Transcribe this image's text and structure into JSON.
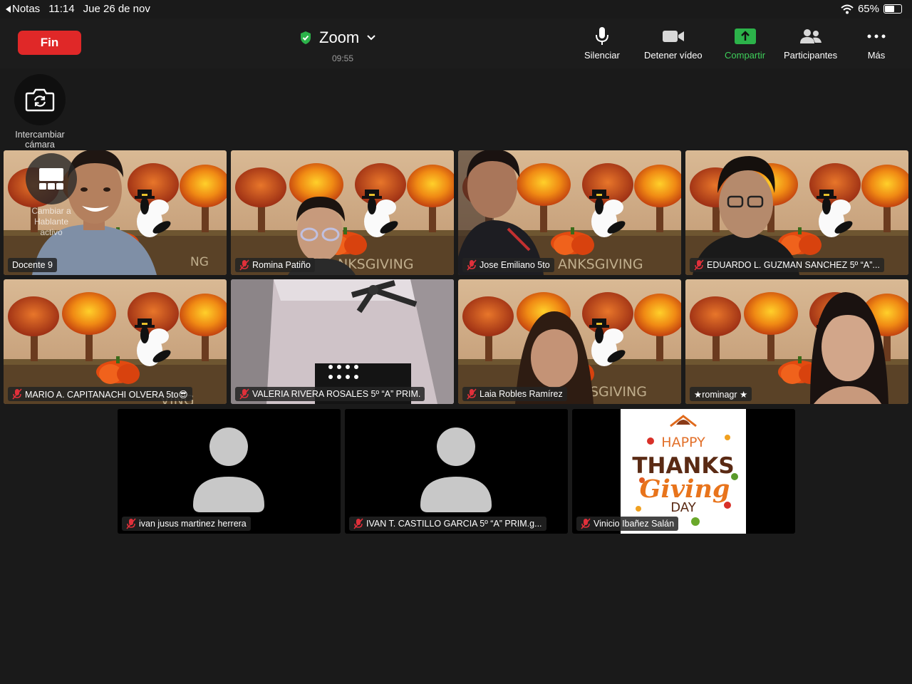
{
  "status_bar": {
    "back_app": "Notas",
    "time": "11:14",
    "date": "Jue 26 de nov",
    "battery": "65%",
    "battery_level": 0.65
  },
  "toolbar": {
    "end_label": "Fin",
    "app_title": "Zoom",
    "meeting_time": "09:55",
    "mute_label": "Silenciar",
    "stop_video_label": "Detener vídeo",
    "share_label": "Compartir",
    "participants_label": "Participantes",
    "more_label": "Más"
  },
  "swap_camera": {
    "line1": "Intercambiar",
    "line2": "cámara"
  },
  "speaker_switch": {
    "line1": "Cambiar a",
    "line2": "Hablante",
    "line3": "activo"
  },
  "colors": {
    "end_red": "#e02828",
    "share_green": "#3ecf5a",
    "active_border": "#3ecf5a",
    "background": "#1a1a1a"
  },
  "participants": [
    {
      "name": "Docente 9",
      "muted": false
    },
    {
      "name": "Romina Patiño",
      "muted": true
    },
    {
      "name": "Jose Emiliano 5to",
      "muted": true
    },
    {
      "name": "EDUARDO L. GUZMAN SANCHEZ 5º “A”...",
      "muted": true
    },
    {
      "name": "MARIO A. CAPITANACHI OLVERA 5to😎",
      "muted": true
    },
    {
      "name": "VALERIA RIVERA ROSALES 5º “A” PRIM.",
      "muted": true
    },
    {
      "name": "Laia Robles Ramírez",
      "muted": true
    },
    {
      "name": "★rominagr ★",
      "muted": false,
      "active": true
    },
    {
      "name": "ivan jusus martinez herrera",
      "muted": true
    },
    {
      "name": "IVAN T. CASTILLO GARCIA 5º “A” PRIM.g...",
      "muted": true
    },
    {
      "name": "Vinicio Ibañez Salán",
      "muted": true
    }
  ],
  "background_text": {
    "thanksgiving": "THANKSGIVING"
  },
  "thanksgiving_card": {
    "line1": "HAPPY",
    "line2": "THANKS",
    "line3": "Giving",
    "line4": "DAY"
  }
}
